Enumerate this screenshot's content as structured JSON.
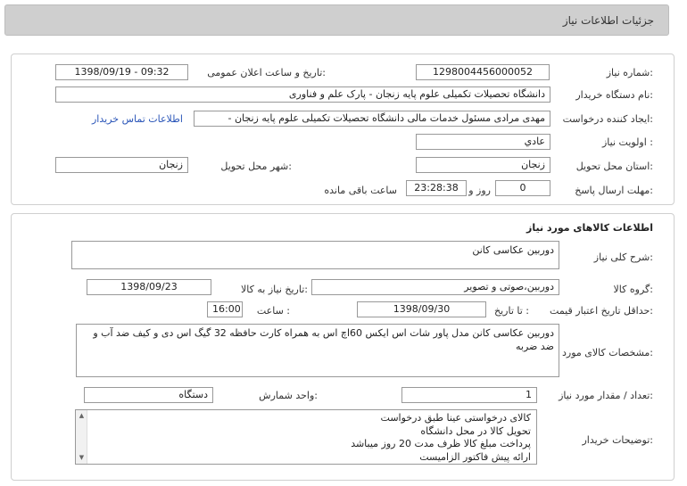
{
  "header": {
    "title": "جزئیات اطلاعات نیاز"
  },
  "info": {
    "need_number_label": "شماره نیاز:",
    "need_number": "1298004456000052",
    "announce_label": "تاریخ و ساعت اعلان عمومی:",
    "announce_value": "1398/09/19 - 09:32",
    "buyer_label": "نام دستگاه خریدار:",
    "buyer_value": "دانشگاه تحصیلات تکمیلی علوم پایه زنجان - پارک علم و فناوری",
    "creator_label": "ایجاد کننده درخواست:",
    "creator_value": "مهدی مرادی مسئول خدمات مالی دانشگاه تحصیلات تکمیلی علوم پایه زنجان -",
    "contact_link": "اطلاعات تماس خریدار",
    "priority_label": "اولویت نیاز :",
    "priority_value": "عادي",
    "province_label": "استان محل تحویل:",
    "province_value": "زنجان",
    "city_label": "شهر محل تحویل:",
    "city_value": "زنجان",
    "deadline_label": "مهلت ارسال پاسخ:",
    "days_value": "0",
    "days_word": "روز و",
    "time_value": "23:28:38",
    "remaining_word": "ساعت باقی مانده"
  },
  "goods": {
    "section_title": "اطلاعات کالاهای مورد نیاز",
    "summary_label": "شرح کلی نیاز:",
    "summary_value": "دوربین عکاسی کانن",
    "group_label": "گروه کالا:",
    "group_value": "دوربین،صوتی و تصویر",
    "need_date_label": "تاریخ نیاز به کالا:",
    "need_date_value": "1398/09/23",
    "min_validity_label": "حداقل تاریخ اعتبار قیمت:",
    "until_label": "تا تاریخ :",
    "validity_date": "1398/09/30",
    "hour_label": "ساعت :",
    "validity_time": "16:00",
    "specs_label": "مشخصات کالای مورد نیاز:",
    "specs_value": "دوربین عکاسی کانن مدل پاور شات اس ایکس 60اچ اس به همراه کارت حافظه 32 گیگ اس دی و کیف ضد آب و ضد ضربه",
    "qty_label": "تعداد / مقدار مورد نیاز:",
    "qty_value": "1",
    "unit_label": "واحد شمارش:",
    "unit_value": "دستگاه",
    "notes_label": "توضیحات خریدار:",
    "notes_lines": [
      "کالای درخواستی عینا طبق درخواست",
      "تحویل کالا در محل دانشگاه",
      "پرداخت مبلغ کالا ظرف مدت 20 روز میباشد",
      "ارائه پیش فاکتور الزامیست"
    ]
  }
}
